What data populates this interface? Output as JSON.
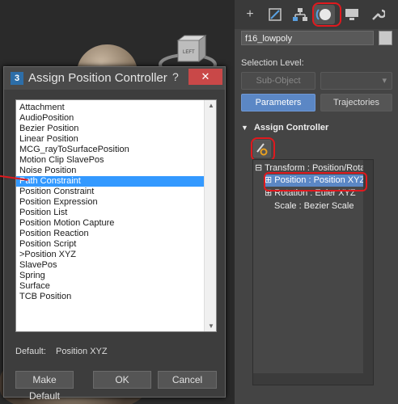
{
  "viewport": {
    "view_cube_label": "LEFT"
  },
  "command_panel": {
    "tabs": [
      {
        "icon": "create-plus-icon",
        "glyph": "+"
      },
      {
        "icon": "modify-icon",
        "glyph": "⛶"
      },
      {
        "icon": "hierarchy-icon",
        "glyph": "⊤"
      },
      {
        "icon": "motion-icon",
        "glyph": "◉"
      },
      {
        "icon": "display-icon",
        "glyph": "▬"
      },
      {
        "icon": "utilities-wrench-icon",
        "glyph": "🔧"
      }
    ],
    "object_name": "f16_lowpoly",
    "object_color": "#c8c8c8",
    "selection_level_label": "Selection Level:",
    "sub_object_label": "Sub-Object",
    "sub_object_dropdown_arrow": "▾",
    "parameters_label": "Parameters",
    "trajectories_label": "Trajectories",
    "assign_controller_label": "Assign Controller",
    "rollout_toggle": "▼",
    "tree": [
      {
        "label": "Transform : Position/Rotat",
        "prefix": "⊟ "
      },
      {
        "label": "Position : Position XYZ",
        "prefix": "⊞ "
      },
      {
        "label": "Rotation : Euler XYZ",
        "prefix": "⊞ "
      },
      {
        "label": "Scale : Bezier Scale",
        "prefix": ""
      }
    ]
  },
  "dialog": {
    "title": "Assign Position Controller",
    "app_icon": "3",
    "help_glyph": "?",
    "close_glyph": "✕",
    "items": [
      "Attachment",
      "AudioPosition",
      "Bezier Position",
      "Linear Position",
      "MCG_rayToSurfacePosition",
      "Motion Clip SlavePos",
      "Noise Position",
      "Path Constraint",
      "Position Constraint",
      "Position Expression",
      "Position List",
      "Position Motion Capture",
      "Position Reaction",
      "Position Script",
      ">Position XYZ",
      "SlavePos",
      "Spring",
      "Surface",
      "TCB Position"
    ],
    "selected_index": 7,
    "default_label": "Default:",
    "default_value": "Position XYZ",
    "make_default_label": "Make Default",
    "ok_label": "OK",
    "cancel_label": "Cancel"
  }
}
